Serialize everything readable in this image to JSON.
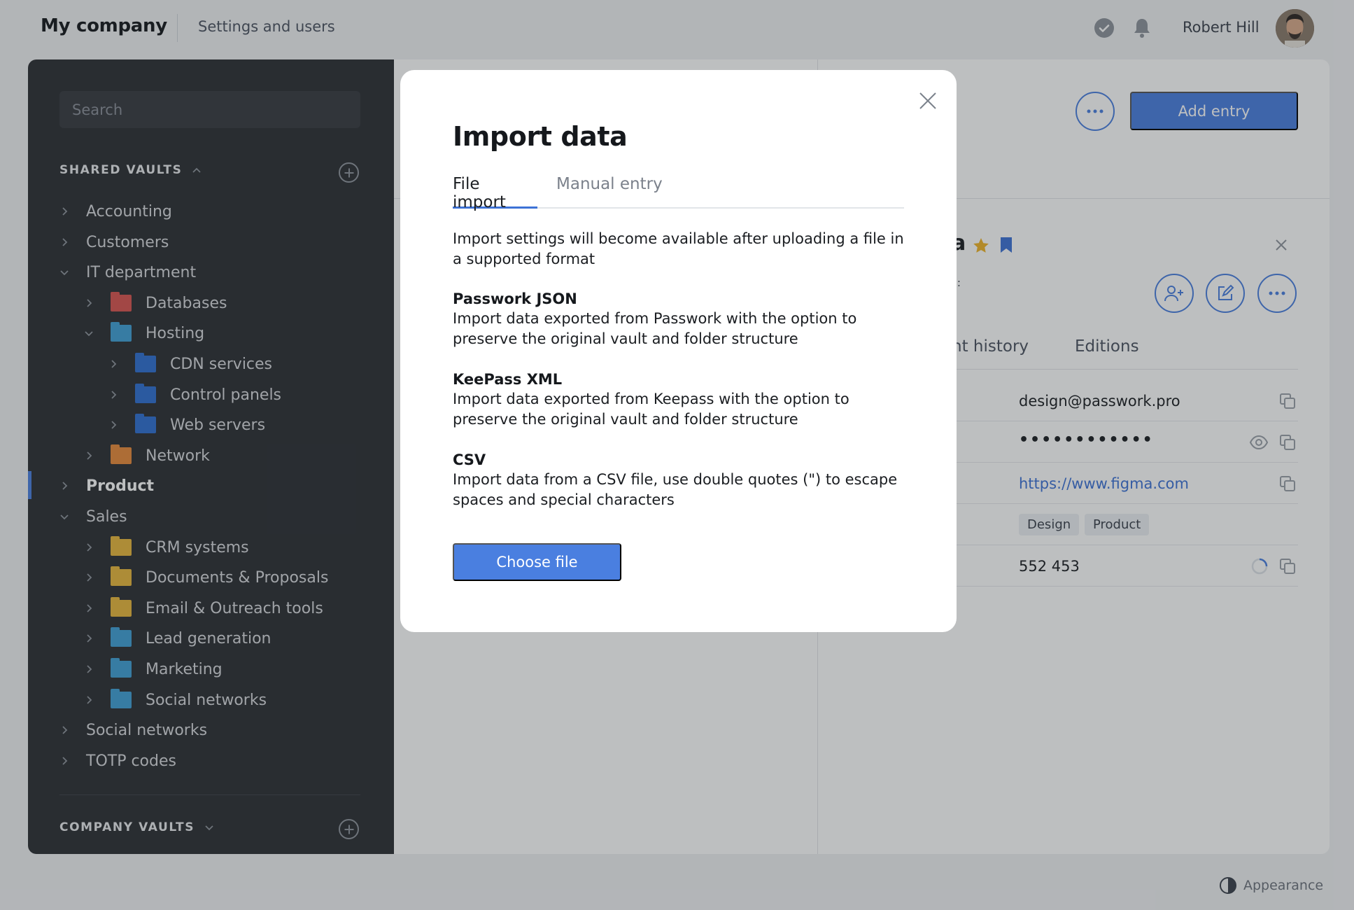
{
  "topbar": {
    "company": "My company",
    "section": "Settings and users",
    "user_name": "Robert Hill"
  },
  "sidebar": {
    "search_placeholder": "Search",
    "shared_vaults_label": "SHARED VAULTS",
    "company_vaults_label": "COMPANY VAULTS",
    "tree": [
      {
        "label": "Accounting",
        "depth": 0,
        "expanded": false,
        "folder_color": null
      },
      {
        "label": "Customers",
        "depth": 0,
        "expanded": false,
        "folder_color": null
      },
      {
        "label": "IT department",
        "depth": 0,
        "expanded": true,
        "folder_color": null
      },
      {
        "label": "Databases",
        "depth": 1,
        "expanded": false,
        "folder_color": "#d9534f"
      },
      {
        "label": "Hosting",
        "depth": 1,
        "expanded": true,
        "folder_color": "#3fa0d6"
      },
      {
        "label": "CDN services",
        "depth": 2,
        "expanded": false,
        "folder_color": "#2f6fd1"
      },
      {
        "label": "Control panels",
        "depth": 2,
        "expanded": false,
        "folder_color": "#2f6fd1"
      },
      {
        "label": "Web servers",
        "depth": 2,
        "expanded": false,
        "folder_color": "#2f6fd1"
      },
      {
        "label": "Network",
        "depth": 1,
        "expanded": false,
        "folder_color": "#e98a3a"
      },
      {
        "label": "Product",
        "depth": 0,
        "expanded": false,
        "folder_color": null,
        "active": true
      },
      {
        "label": "Sales",
        "depth": 0,
        "expanded": true,
        "folder_color": null
      },
      {
        "label": "CRM systems",
        "depth": 1,
        "expanded": false,
        "folder_color": "#e9b63c"
      },
      {
        "label": "Documents & Proposals",
        "depth": 1,
        "expanded": false,
        "folder_color": "#e9b63c"
      },
      {
        "label": "Email & Outreach tools",
        "depth": 1,
        "expanded": false,
        "folder_color": "#e9b63c"
      },
      {
        "label": "Lead generation",
        "depth": 1,
        "expanded": false,
        "folder_color": "#3fa0d6"
      },
      {
        "label": "Marketing",
        "depth": 1,
        "expanded": false,
        "folder_color": "#3fa0d6"
      },
      {
        "label": "Social networks",
        "depth": 1,
        "expanded": false,
        "folder_color": "#3fa0d6"
      },
      {
        "label": "Social networks",
        "depth": 0,
        "expanded": false,
        "folder_color": null
      },
      {
        "label": "TOTP codes",
        "depth": 0,
        "expanded": false,
        "folder_color": null
      }
    ]
  },
  "toolbar": {
    "add_entry_label": "Add entry"
  },
  "entry": {
    "title_fragment": "a",
    "subtitle_fragment": "s:",
    "tab_history_fragment": "nt history",
    "tab_editions": "Editions",
    "fields": {
      "login": "design@passwork.pro",
      "password": "••••••••••••",
      "url": "https://www.figma.com",
      "tags": [
        "Design",
        "Product"
      ],
      "otp": "552 453"
    }
  },
  "footer": {
    "appearance_label": "Appearance"
  },
  "modal": {
    "title": "Import data",
    "tabs": [
      "File import",
      "Manual entry"
    ],
    "active_tab": "File import",
    "intro": "Import settings will become available after uploading a file in a supported format",
    "formats": [
      {
        "name": "Passwork JSON",
        "description": "Import data exported from Passwork with the option to preserve the original vault and folder structure"
      },
      {
        "name": "KeePass XML",
        "description": "Import data exported from Keepass with the option to preserve the original vault and folder structure"
      },
      {
        "name": "CSV",
        "description": "Import data from a CSV file, use double quotes (\") to escape spaces and special characters"
      }
    ],
    "choose_file_label": "Choose file"
  },
  "colors": {
    "accent": "#4a7fe0",
    "sidebar_bg": "#2b2e33",
    "star": "#f0b429"
  }
}
